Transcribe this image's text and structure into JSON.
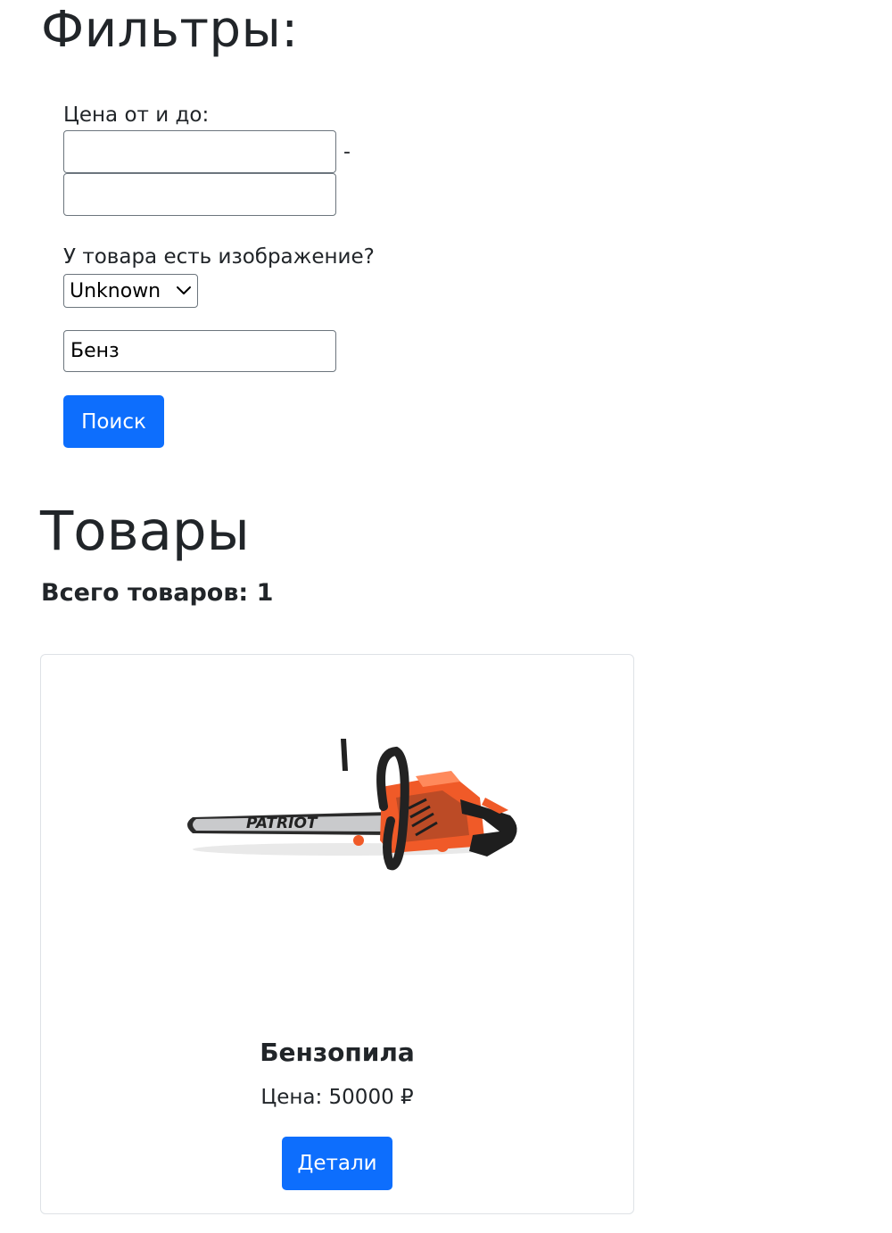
{
  "filters": {
    "title": "Фильтры:",
    "price_label": "Цена от и до:",
    "price_from_value": "",
    "price_separator": "-",
    "price_to_value": "",
    "has_image_label": "У товара есть изображение?",
    "has_image_selected": "Unknown",
    "search_value": "Бенз",
    "search_button_label": "Поиск"
  },
  "products": {
    "title": "Товары",
    "count_text": "Всего товаров: 1",
    "items": [
      {
        "name": "Бензопила",
        "price_text": "Цена: 50000 ₽",
        "details_button_label": "Детали",
        "image_brand_text": "PATRIOT"
      }
    ]
  },
  "colors": {
    "primary": "#0d6efd",
    "text": "#212529",
    "border": "#dee2e6",
    "saw_body": "#f05a28"
  }
}
